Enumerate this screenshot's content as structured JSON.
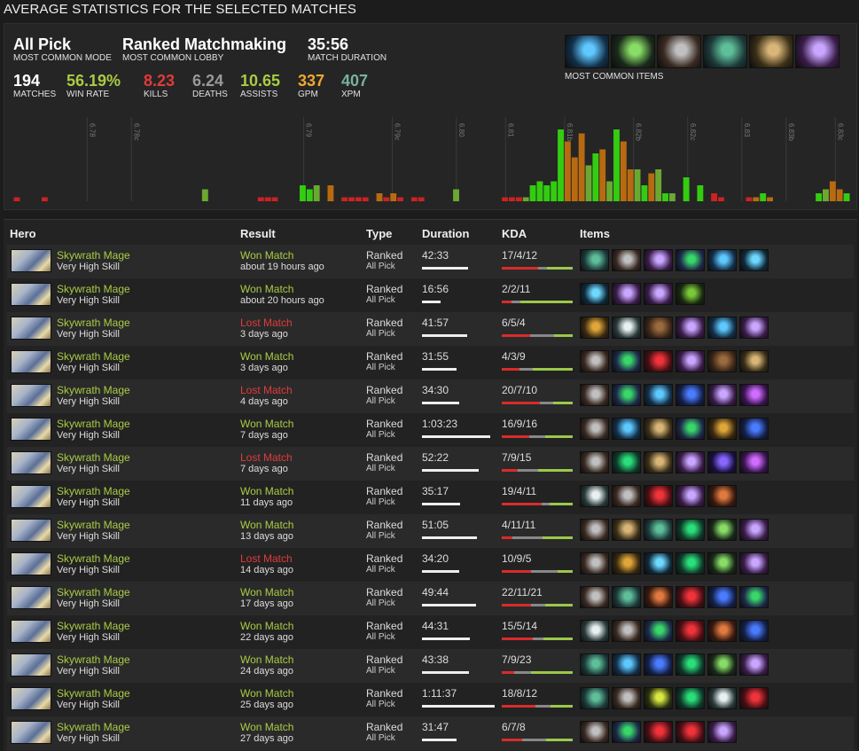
{
  "page_title": "AVERAGE STATISTICS FOR THE SELECTED MATCHES",
  "summary": {
    "mode": {
      "value": "All Pick",
      "label": "MOST COMMON MODE"
    },
    "lobby": {
      "value": "Ranked Matchmaking",
      "label": "MOST COMMON LOBBY"
    },
    "duration": {
      "value": "35:56",
      "label": "MATCH DURATION"
    },
    "stats": [
      {
        "value": "194",
        "label": "MATCHES",
        "color": "#ffffff"
      },
      {
        "value": "56.19%",
        "label": "WIN RATE",
        "color": "#a8cc44"
      },
      {
        "value": "8.23",
        "label": "KILLS",
        "color": "#e03b3b"
      },
      {
        "value": "6.24",
        "label": "DEATHS",
        "color": "#999999"
      },
      {
        "value": "10.65",
        "label": "ASSISTS",
        "color": "#a8cc44"
      },
      {
        "value": "337",
        "label": "GPM",
        "color": "#f0a830"
      },
      {
        "value": "407",
        "label": "XPM",
        "color": "#7ab0a0"
      }
    ],
    "common_items_label": "MOST COMMON ITEMS",
    "common_items": [
      "arcane-boots-icon",
      "force-staff-icon",
      "boots-icon",
      "eul-scepter-icon",
      "scroll-icon",
      "dagon-icon"
    ]
  },
  "chart_data": {
    "type": "bar",
    "patch_labels": [
      "6.78",
      "6.78c",
      "6.79",
      "6.79c",
      "6.80",
      "6.81",
      "6.81b",
      "6.82b",
      "6.82c",
      "6.83",
      "6.83b",
      "6.83c"
    ],
    "values": [
      1,
      0,
      0,
      0,
      1,
      0,
      0,
      0,
      0,
      0,
      0,
      0,
      0,
      0,
      0,
      0,
      0,
      0,
      0,
      0,
      0,
      0,
      0,
      0,
      0,
      0,
      0,
      3,
      0,
      0,
      0,
      0,
      0,
      0,
      0,
      1,
      1,
      1,
      0,
      0,
      0,
      4,
      3,
      4,
      0,
      4,
      0,
      1,
      1,
      1,
      1,
      0,
      2,
      1,
      2,
      1,
      0,
      1,
      1,
      0,
      0,
      0,
      0,
      3,
      0,
      0,
      0,
      0,
      0,
      0,
      1,
      1,
      1,
      1,
      4,
      5,
      4,
      5,
      18,
      15,
      11,
      17,
      9,
      12,
      13,
      5,
      18,
      15,
      8,
      8,
      4,
      7,
      8,
      2,
      2,
      0,
      6,
      0,
      4,
      0,
      2,
      1,
      0,
      0,
      0,
      1,
      1,
      2,
      1,
      0,
      0,
      0,
      0,
      0,
      0,
      2,
      3,
      5,
      3,
      2
    ],
    "colors": [
      "#cc2222",
      "#6aa832",
      "#b86a10",
      "#33cc11"
    ],
    "series_color_index": [
      0,
      0,
      0,
      0,
      0,
      0,
      0,
      0,
      0,
      0,
      0,
      0,
      0,
      0,
      0,
      0,
      0,
      0,
      0,
      0,
      0,
      0,
      0,
      0,
      0,
      0,
      0,
      1,
      0,
      0,
      0,
      0,
      0,
      0,
      0,
      0,
      0,
      0,
      0,
      0,
      0,
      3,
      3,
      1,
      0,
      2,
      0,
      0,
      0,
      0,
      0,
      0,
      2,
      0,
      2,
      0,
      0,
      0,
      0,
      0,
      0,
      0,
      0,
      1,
      0,
      0,
      0,
      0,
      0,
      0,
      0,
      0,
      0,
      1,
      3,
      3,
      3,
      3,
      3,
      2,
      2,
      2,
      1,
      3,
      2,
      1,
      3,
      2,
      2,
      1,
      3,
      2,
      1,
      3,
      1,
      0,
      3,
      0,
      3,
      0,
      0,
      0,
      0,
      0,
      0,
      0,
      2,
      3,
      2,
      0,
      0,
      0,
      0,
      0,
      0,
      3,
      1,
      2,
      2,
      3
    ]
  },
  "table": {
    "headers": {
      "hero": "Hero",
      "result": "Result",
      "type": "Type",
      "duration": "Duration",
      "kda": "KDA",
      "items": "Items"
    },
    "rows": [
      {
        "hero": "Skywrath Mage",
        "skill": "Very High Skill",
        "result": "Won Match",
        "won": true,
        "ago": "about 19 hours ago",
        "type": "Ranked",
        "mode": "All Pick",
        "duration": "42:33",
        "dur_frac": 0.63,
        "kda": "17/4/12",
        "k": 17,
        "d": 4,
        "a": 12,
        "items": [
          "eul",
          "boots",
          "dagon",
          "gem",
          "arcane",
          "blink"
        ]
      },
      {
        "hero": "Skywrath Mage",
        "skill": "Very High Skill",
        "result": "Won Match",
        "won": true,
        "ago": "about 20 hours ago",
        "type": "Ranked",
        "mode": "All Pick",
        "duration": "16:56",
        "dur_frac": 0.25,
        "kda": "2/2/11",
        "k": 2,
        "d": 2,
        "a": 11,
        "items": [
          "blink",
          "dagon",
          "dagon",
          "salve"
        ]
      },
      {
        "hero": "Skywrath Mage",
        "skill": "Very High Skill",
        "result": "Lost Match",
        "won": false,
        "ago": "3 days ago",
        "type": "Ranked",
        "mode": "All Pick",
        "duration": "41:57",
        "dur_frac": 0.62,
        "kda": "6/5/4",
        "k": 6,
        "d": 5,
        "a": 4,
        "items": [
          "orb",
          "wind",
          "boots2",
          "dagon",
          "arcane",
          "dagon"
        ]
      },
      {
        "hero": "Skywrath Mage",
        "skill": "Very High Skill",
        "result": "Won Match",
        "won": true,
        "ago": "3 days ago",
        "type": "Ranked",
        "mode": "All Pick",
        "duration": "31:55",
        "dur_frac": 0.47,
        "kda": "4/3/9",
        "k": 4,
        "d": 3,
        "a": 9,
        "items": [
          "boots",
          "gem",
          "red",
          "dagon",
          "boots2",
          "scroll"
        ]
      },
      {
        "hero": "Skywrath Mage",
        "skill": "Very High Skill",
        "result": "Lost Match",
        "won": false,
        "ago": "4 days ago",
        "type": "Ranked",
        "mode": "All Pick",
        "duration": "34:30",
        "dur_frac": 0.51,
        "kda": "20/7/10",
        "k": 20,
        "d": 7,
        "a": 10,
        "items": [
          "boots",
          "gem",
          "arcane",
          "scepter",
          "dagon",
          "purple"
        ]
      },
      {
        "hero": "Skywrath Mage",
        "skill": "Very High Skill",
        "result": "Won Match",
        "won": true,
        "ago": "7 days ago",
        "type": "Ranked",
        "mode": "All Pick",
        "duration": "1:03:23",
        "dur_frac": 0.94,
        "kda": "16/9/16",
        "k": 16,
        "d": 9,
        "a": 16,
        "items": [
          "boots",
          "arcane",
          "scroll",
          "gem",
          "orb",
          "scepter"
        ]
      },
      {
        "hero": "Skywrath Mage",
        "skill": "Very High Skill",
        "result": "Lost Match",
        "won": false,
        "ago": "7 days ago",
        "type": "Ranked",
        "mode": "All Pick",
        "duration": "52:22",
        "dur_frac": 0.78,
        "kda": "7/9/15",
        "k": 7,
        "d": 9,
        "a": 15,
        "items": [
          "boots",
          "green",
          "scroll",
          "dagon",
          "purple2",
          "purple"
        ]
      },
      {
        "hero": "Skywrath Mage",
        "skill": "Very High Skill",
        "result": "Won Match",
        "won": true,
        "ago": "11 days ago",
        "type": "Ranked",
        "mode": "All Pick",
        "duration": "35:17",
        "dur_frac": 0.52,
        "kda": "19/4/11",
        "k": 19,
        "d": 4,
        "a": 11,
        "items": [
          "wind",
          "boots",
          "red",
          "dagon",
          "boots3"
        ]
      },
      {
        "hero": "Skywrath Mage",
        "skill": "Very High Skill",
        "result": "Won Match",
        "won": true,
        "ago": "13 days ago",
        "type": "Ranked",
        "mode": "All Pick",
        "duration": "51:05",
        "dur_frac": 0.76,
        "kda": "4/11/11",
        "k": 4,
        "d": 11,
        "a": 11,
        "items": [
          "boots",
          "scroll",
          "eul",
          "green",
          "force",
          "dagon"
        ]
      },
      {
        "hero": "Skywrath Mage",
        "skill": "Very High Skill",
        "result": "Lost Match",
        "won": false,
        "ago": "14 days ago",
        "type": "Ranked",
        "mode": "All Pick",
        "duration": "34:20",
        "dur_frac": 0.51,
        "kda": "10/9/5",
        "k": 10,
        "d": 9,
        "a": 5,
        "items": [
          "boots",
          "orb",
          "blink",
          "green",
          "force",
          "dagon"
        ]
      },
      {
        "hero": "Skywrath Mage",
        "skill": "Very High Skill",
        "result": "Won Match",
        "won": true,
        "ago": "17 days ago",
        "type": "Ranked",
        "mode": "All Pick",
        "duration": "49:44",
        "dur_frac": 0.74,
        "kda": "22/11/21",
        "k": 22,
        "d": 11,
        "a": 21,
        "items": [
          "boots",
          "eul",
          "boots3",
          "red",
          "scepter",
          "gem"
        ]
      },
      {
        "hero": "Skywrath Mage",
        "skill": "Very High Skill",
        "result": "Won Match",
        "won": true,
        "ago": "22 days ago",
        "type": "Ranked",
        "mode": "All Pick",
        "duration": "44:31",
        "dur_frac": 0.66,
        "kda": "15/5/14",
        "k": 15,
        "d": 5,
        "a": 14,
        "items": [
          "wind",
          "boots",
          "gem",
          "red",
          "boots3",
          "scepter"
        ]
      },
      {
        "hero": "Skywrath Mage",
        "skill": "Very High Skill",
        "result": "Won Match",
        "won": true,
        "ago": "24 days ago",
        "type": "Ranked",
        "mode": "All Pick",
        "duration": "43:38",
        "dur_frac": 0.65,
        "kda": "7/9/23",
        "k": 7,
        "d": 9,
        "a": 23,
        "items": [
          "eul",
          "arcane",
          "scepter",
          "green",
          "force",
          "dagon"
        ]
      },
      {
        "hero": "Skywrath Mage",
        "skill": "Very High Skill",
        "result": "Won Match",
        "won": true,
        "ago": "25 days ago",
        "type": "Ranked",
        "mode": "All Pick",
        "duration": "1:11:37",
        "dur_frac": 1.0,
        "kda": "18/8/12",
        "k": 18,
        "d": 8,
        "a": 12,
        "items": [
          "eul",
          "boots",
          "yellow",
          "green",
          "wind",
          "red"
        ]
      },
      {
        "hero": "Skywrath Mage",
        "skill": "Very High Skill",
        "result": "Won Match",
        "won": true,
        "ago": "27 days ago",
        "type": "Ranked",
        "mode": "All Pick",
        "duration": "31:47",
        "dur_frac": 0.47,
        "kda": "6/7/8",
        "k": 6,
        "d": 7,
        "a": 8,
        "items": [
          "boots",
          "gem",
          "red",
          "red",
          "dagon"
        ]
      }
    ]
  },
  "item_colors": {
    "eul": [
      "#1d3a3a",
      "#5fbf9a"
    ],
    "boots": [
      "#3a2a22",
      "#c0c0c0"
    ],
    "dagon": [
      "#3a1d4a",
      "#c9a6ff"
    ],
    "gem": [
      "#1d2a4a",
      "#39d66a"
    ],
    "arcane": [
      "#13304a",
      "#5ec8ff"
    ],
    "blink": [
      "#0f2a3a",
      "#6fd8ff"
    ],
    "salve": [
      "#1a2a10",
      "#78c838"
    ],
    "orb": [
      "#3a2a10",
      "#e0a63a"
    ],
    "wind": [
      "#2a3a3a",
      "#e8f0f0"
    ],
    "boots2": [
      "#3a2618",
      "#9b6a3e"
    ],
    "red": [
      "#4a0f14",
      "#f0333b"
    ],
    "scroll": [
      "#3a2f18",
      "#d9b578"
    ],
    "scepter": [
      "#14204a",
      "#4a7cff"
    ],
    "purple": [
      "#3a1450",
      "#d06cff"
    ],
    "purple2": [
      "#1a1040",
      "#8866ff"
    ],
    "green": [
      "#0f3a2a",
      "#2adf7a"
    ],
    "boots3": [
      "#3a1a10",
      "#e07a40"
    ],
    "force": [
      "#1a2a1a",
      "#88dd66"
    ],
    "yellow": [
      "#2a3010",
      "#d8e840"
    ]
  }
}
